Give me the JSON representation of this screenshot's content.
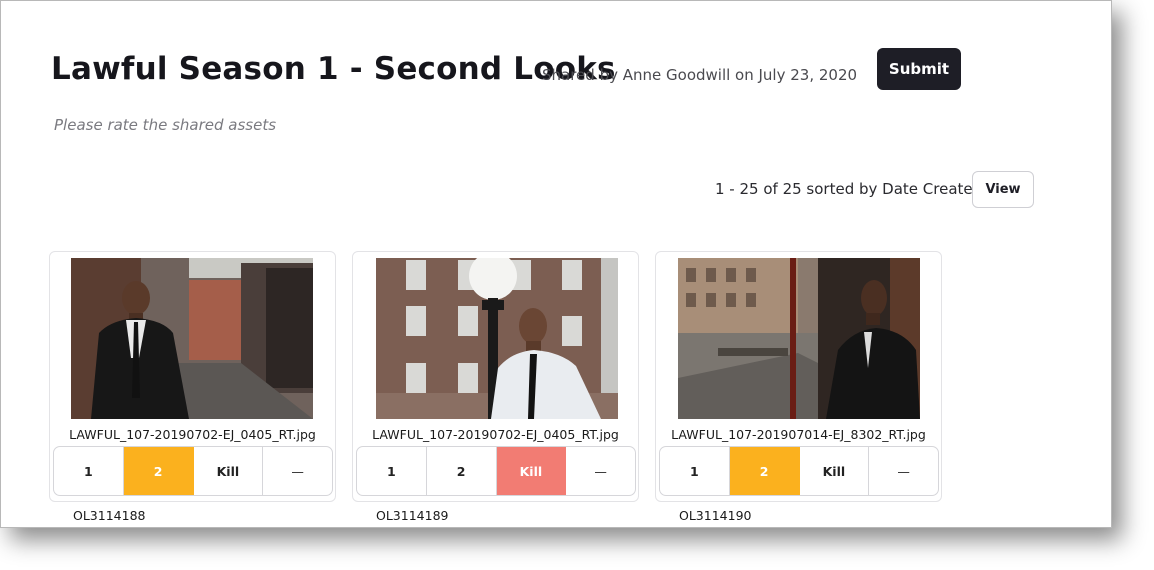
{
  "header": {
    "title": "Lawful Season 1 - Second Looks",
    "shared_by": "Shared by Anne Goodwill on July 23, 2020",
    "submit_label": "Submit",
    "subtitle": "Please rate the shared assets"
  },
  "toolbar": {
    "sort_info": "1 - 25 of 25 sorted by Date Created",
    "view_label": "View"
  },
  "rating_options": [
    "1",
    "2",
    "Kill",
    "—"
  ],
  "assets": [
    {
      "filename": "LAWFUL_107-20190702-EJ_0405_RT.jpg",
      "id": "OL3114188",
      "selected": "2",
      "image": "man-in-alley-photo"
    },
    {
      "filename": "LAWFUL_107-20190702-EJ_0405_RT.jpg",
      "id": "OL3114189",
      "selected": "Kill",
      "image": "man-by-lamppost-photo"
    },
    {
      "filename": "LAWFUL_107-201907014-EJ_8302_RT.jpg",
      "id": "OL3114190",
      "selected": "2",
      "image": "man-on-street-photo"
    }
  ],
  "colors": {
    "selected_rating": "#fbb11e",
    "kill_selected": "#f27c73",
    "dark_button": "#1e1e26"
  }
}
